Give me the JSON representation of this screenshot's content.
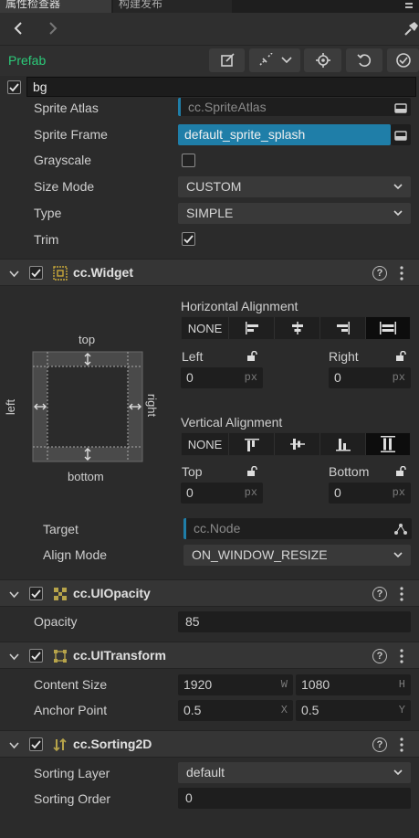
{
  "tabs": {
    "inspector": "属性检查器",
    "build": "构建发布"
  },
  "prefab": {
    "label": "Prefab"
  },
  "node": {
    "name": "bg"
  },
  "sprite": {
    "atlas_label": "Sprite Atlas",
    "atlas_value": "cc.SpriteAtlas",
    "frame_label": "Sprite Frame",
    "frame_value": "default_sprite_splash",
    "grayscale_label": "Grayscale",
    "size_mode_label": "Size Mode",
    "size_mode_value": "CUSTOM",
    "type_label": "Type",
    "type_value": "SIMPLE",
    "trim_label": "Trim"
  },
  "widget": {
    "title": "cc.Widget",
    "help": "?",
    "horiz_label": "Horizontal Alignment",
    "horiz_none": "NONE",
    "left_label": "Left",
    "left_value": "0",
    "left_unit": "px",
    "right_label": "Right",
    "right_value": "0",
    "right_unit": "px",
    "vert_label": "Vertical Alignment",
    "vert_none": "NONE",
    "top_label": "Top",
    "top_value": "0",
    "top_unit": "px",
    "bottom_label": "Bottom",
    "bottom_value": "0",
    "bottom_unit": "px",
    "diagram": {
      "top": "top",
      "bottom": "bottom",
      "left": "left",
      "right": "right"
    },
    "target_label": "Target",
    "target_value": "cc.Node",
    "align_mode_label": "Align Mode",
    "align_mode_value": "ON_WINDOW_RESIZE"
  },
  "opacity": {
    "title": "cc.UIOpacity",
    "help": "?",
    "label": "Opacity",
    "value": "85"
  },
  "transform": {
    "title": "cc.UITransform",
    "help": "?",
    "content_size_label": "Content Size",
    "width": "1920",
    "width_unit": "W",
    "height": "1080",
    "height_unit": "H",
    "anchor_label": "Anchor Point",
    "anchor_x": "0.5",
    "anchor_x_unit": "X",
    "anchor_y": "0.5",
    "anchor_y_unit": "Y"
  },
  "sorting": {
    "title": "cc.Sorting2D",
    "help": "?",
    "layer_label": "Sorting Layer",
    "layer_value": "default",
    "order_label": "Sorting Order",
    "order_value": "0"
  },
  "colors": {
    "prefab_green": "#2ccb7a",
    "selection_blue": "#1f7ea8"
  }
}
